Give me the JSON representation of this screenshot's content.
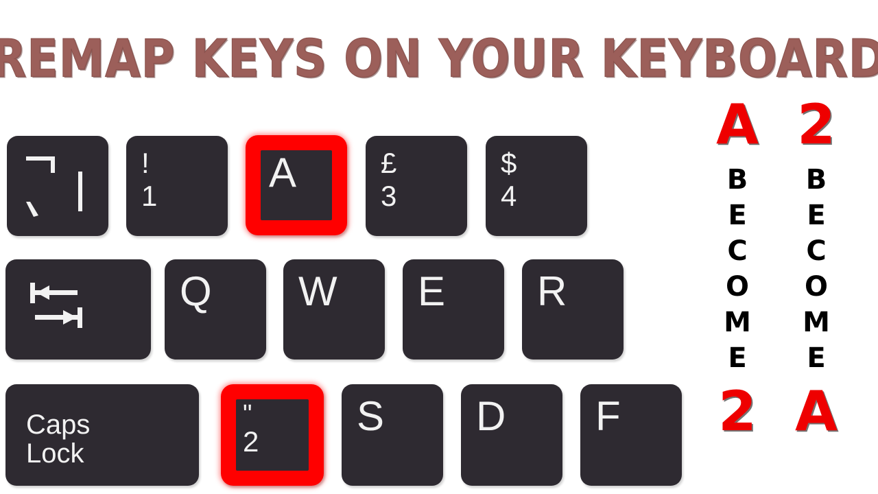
{
  "title": "REMAP KEYS ON YOUR KEYBOARD",
  "colors": {
    "background": "#ffffff",
    "key_face": "#2e2a31",
    "key_text": "#f2f2f2",
    "highlight": "#ff0000",
    "title": "#9c5f5a",
    "becomes_accent": "#ee0000",
    "becomes_text": "#000000"
  },
  "keyboard": {
    "rows": [
      {
        "name": "number-row",
        "keys": [
          {
            "id": "backtick",
            "type": "symbols",
            "icons": [
              "not-sign-icon",
              "grave-accent-icon",
              "pipe-icon"
            ],
            "shift": "¬",
            "base": "`",
            "extra": "|",
            "highlighted": false
          },
          {
            "id": "1",
            "type": "dual",
            "shift": "!",
            "base": "1",
            "highlighted": false
          },
          {
            "id": "a-top",
            "type": "letter",
            "label": "A",
            "highlighted": true
          },
          {
            "id": "3",
            "type": "dual",
            "shift": "£",
            "base": "3",
            "highlighted": false
          },
          {
            "id": "4",
            "type": "dual",
            "shift": "$",
            "base": "4",
            "highlighted": false
          }
        ]
      },
      {
        "name": "top-letter-row",
        "keys": [
          {
            "id": "tab",
            "type": "icon",
            "icon": "tab-arrows-icon",
            "label": "Tab",
            "highlighted": false
          },
          {
            "id": "q",
            "type": "letter",
            "label": "Q",
            "highlighted": false
          },
          {
            "id": "w",
            "type": "letter",
            "label": "W",
            "highlighted": false
          },
          {
            "id": "e",
            "type": "letter",
            "label": "E",
            "highlighted": false
          },
          {
            "id": "r",
            "type": "letter",
            "label": "R",
            "highlighted": false
          }
        ]
      },
      {
        "name": "home-row",
        "keys": [
          {
            "id": "capslock",
            "type": "word",
            "label": "Caps\nLock",
            "highlighted": false
          },
          {
            "id": "2-bottom",
            "type": "dual",
            "shift": "\"",
            "base": "2",
            "highlighted": true
          },
          {
            "id": "s",
            "type": "letter",
            "label": "S",
            "highlighted": false
          },
          {
            "id": "d",
            "type": "letter",
            "label": "D",
            "highlighted": false
          },
          {
            "id": "f",
            "type": "letter",
            "label": "F",
            "highlighted": false
          }
        ]
      }
    ]
  },
  "becomes": {
    "left": {
      "from": "A",
      "word": [
        "B",
        "E",
        "C",
        "O",
        "M",
        "E"
      ],
      "to": "2"
    },
    "right": {
      "from": "2",
      "word": [
        "B",
        "E",
        "C",
        "O",
        "M",
        "E"
      ],
      "to": "A"
    }
  }
}
